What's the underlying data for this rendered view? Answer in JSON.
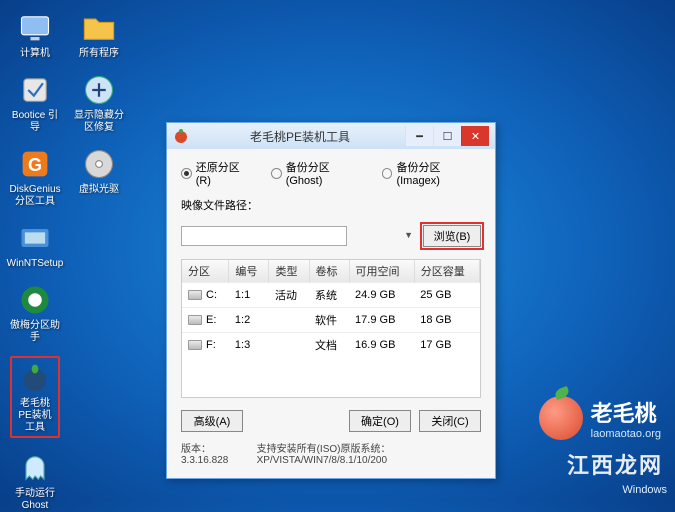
{
  "desktop": {
    "row1": {
      "computer": "计算机",
      "programs": "所有程序"
    },
    "row2": {
      "bootice": "Bootice 引导",
      "partfix": "显示隐藏分区修复"
    },
    "row3": {
      "diskgenius_l1": "DiskGenius",
      "diskgenius_l2": "分区工具",
      "vdrive": "虚拟光驱"
    },
    "row4": {
      "winnt": "WinNTSetup"
    },
    "row5": {
      "aomei": "傲梅分区助手"
    },
    "row6": {
      "lmtpe_l1": "老毛桃PE装机",
      "lmtpe_l2": "工具"
    },
    "row7": {
      "ghost_l1": "手动运行",
      "ghost_l2": "Ghost"
    }
  },
  "window": {
    "title": "老毛桃PE装机工具",
    "radios": {
      "restore": "还原分区(R)",
      "backup_ghost": "备份分区(Ghost)",
      "backup_imagex": "备份分区(Imagex)"
    },
    "path_label": "映像文件路径：",
    "path_value": "",
    "browse": "浏览(B)",
    "table": {
      "headers": {
        "part": "分区",
        "num": "编号",
        "type": "类型",
        "label": "卷标",
        "free": "可用空间",
        "cap": "分区容量"
      },
      "rows": [
        {
          "part": "C:",
          "num": "1:1",
          "type": "活动",
          "label": "系统",
          "free": "24.9 GB",
          "cap": "25 GB"
        },
        {
          "part": "E:",
          "num": "1:2",
          "type": "",
          "label": "软件",
          "free": "17.9 GB",
          "cap": "18 GB"
        },
        {
          "part": "F:",
          "num": "1:3",
          "type": "",
          "label": "文档",
          "free": "16.9 GB",
          "cap": "17 GB"
        }
      ]
    },
    "advanced": "高级(A)",
    "ok": "确定(O)",
    "close": "关闭(C)",
    "version_label": "版本：",
    "version": "3.3.16.828",
    "support": "支持安装所有(ISO)原版系统：XP/VISTA/WIN7/8/8.1/10/200"
  },
  "logo": {
    "cn": "老毛桃",
    "url": "laomaotao.org"
  },
  "watermark": "江西龙网",
  "os_mark": "Windows"
}
